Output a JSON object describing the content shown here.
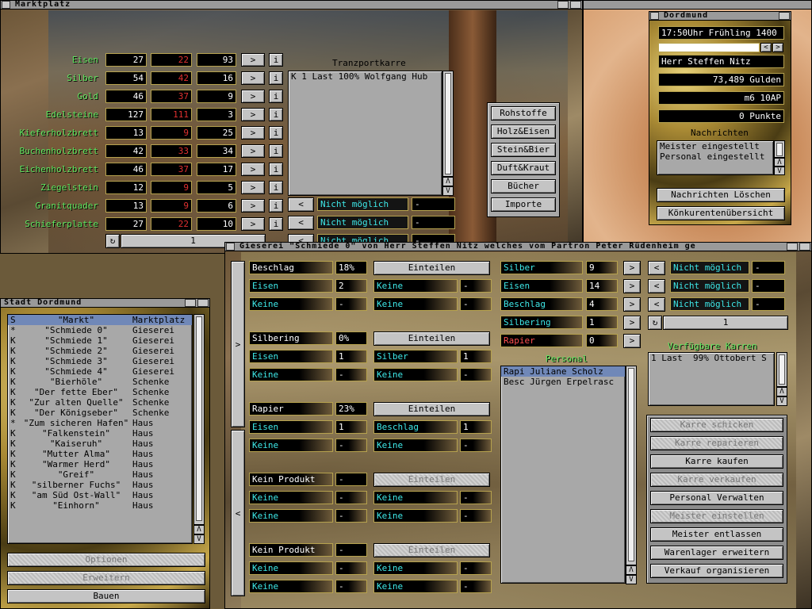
{
  "markt": {
    "title": "Marktplatz",
    "transport_title": "Tranzportkarre",
    "transport_items": [
      "K 1 Last 100% Wolfgang Hub"
    ],
    "goods": [
      {
        "name": "Eisen",
        "stock": "27",
        "price": "22",
        "own": "93"
      },
      {
        "name": "Silber",
        "stock": "54",
        "price": "42",
        "own": "16"
      },
      {
        "name": "Gold",
        "stock": "46",
        "price": "37",
        "own": "9"
      },
      {
        "name": "Edelsteine",
        "stock": "127",
        "price": "111",
        "own": "3"
      },
      {
        "name": "Kieferholzbrett",
        "stock": "13",
        "price": "9",
        "own": "25"
      },
      {
        "name": "Buchenholzbrett",
        "stock": "42",
        "price": "33",
        "own": "34"
      },
      {
        "name": "Eichenholzbrett",
        "stock": "46",
        "price": "37",
        "own": "17"
      },
      {
        "name": "Ziegelstein",
        "stock": "12",
        "price": "9",
        "own": "5"
      },
      {
        "name": "Granitquader",
        "stock": "13",
        "price": "9",
        "own": "6"
      },
      {
        "name": "Schieferplatte",
        "stock": "27",
        "price": "22",
        "own": "10"
      }
    ],
    "arrow_right": ">",
    "arrow_left": "<",
    "info": "i",
    "counter_icon": "↻",
    "counter_value": "1",
    "dash": "-",
    "not_possible": "Nicht möglich",
    "categories": [
      "Rohstoffe",
      "Holz&Eisen",
      "Stein&Bier",
      "Duft&Kraut",
      "Bücher",
      "Importe"
    ]
  },
  "dordmund": {
    "title": "Dordmund",
    "time": "17:50Uhr Frühling 1400",
    "player": "Herr Steffen Nitz",
    "gold": "73,489 Gulden",
    "ap": "m6 10AP",
    "points": "0 Punkte",
    "news_title": "Nachrichten",
    "news": [
      "Meister eingestellt",
      "Personal eingestellt"
    ],
    "btn_clear": "Nachrichten Löschen",
    "btn_competitors": "Könkurentenübersicht",
    "arrow_left": "<",
    "arrow_right": ">"
  },
  "stadt": {
    "title": "Stadt Dordmund",
    "buildings": [
      {
        "k": "S",
        "name": "\"Markt\"",
        "type": "Marktplatz"
      },
      {
        "k": "*",
        "name": "\"Schmiede 0\"",
        "type": "Gieserei"
      },
      {
        "k": "K",
        "name": "\"Schmiede 1\"",
        "type": "Gieserei"
      },
      {
        "k": "K",
        "name": "\"Schmiede 2\"",
        "type": "Gieserei"
      },
      {
        "k": "K",
        "name": "\"Schmiede 3\"",
        "type": "Gieserei"
      },
      {
        "k": "K",
        "name": "\"Schmiede 4\"",
        "type": "Gieserei"
      },
      {
        "k": "K",
        "name": "\"Bierhöle\"",
        "type": "Schenke"
      },
      {
        "k": "K",
        "name": "\"Der fette Eber\"",
        "type": "Schenke"
      },
      {
        "k": "K",
        "name": "\"Zur alten Quelle\"",
        "type": "Schenke"
      },
      {
        "k": "K",
        "name": "\"Der Königseber\"",
        "type": "Schenke"
      },
      {
        "k": "*",
        "name": "\"Zum sicheren Hafen\"",
        "type": "Haus"
      },
      {
        "k": "K",
        "name": "\"Falkenstein\"",
        "type": "Haus"
      },
      {
        "k": "K",
        "name": "\"Kaiseruh\"",
        "type": "Haus"
      },
      {
        "k": "K",
        "name": "\"Mutter Alma\"",
        "type": "Haus"
      },
      {
        "k": "K",
        "name": "\"Warmer Herd\"",
        "type": "Haus"
      },
      {
        "k": "K",
        "name": "\"Greif\"",
        "type": "Haus"
      },
      {
        "k": "K",
        "name": "\"silberner Fuchs\"",
        "type": "Haus"
      },
      {
        "k": "K",
        "name": "\"am Süd Ost-Wall\"",
        "type": "Haus"
      },
      {
        "k": "K",
        "name": "\"Einhorn\"",
        "type": "Haus"
      }
    ],
    "btn_options": "Optionen",
    "btn_expand": "Erweitern",
    "btn_build": "Bauen"
  },
  "gieserei": {
    "title": "Gieserei \"Schmiede 0\" von Herr Steffen Nitz welches vom Partron Peter Rüdenheim ge",
    "prod": [
      {
        "product": "Beschlag",
        "pct": "18%",
        "in": [
          {
            "a": "Eisen",
            "b": "2",
            "c": "Keine",
            "d": "-"
          },
          {
            "a": "Keine",
            "b": "-",
            "c": "Keine",
            "d": "-"
          }
        ]
      },
      {
        "product": "Silbering",
        "pct": "0%",
        "in": [
          {
            "a": "Eisen",
            "b": "1",
            "c": "Silber",
            "d": "1"
          },
          {
            "a": "Keine",
            "b": "-",
            "c": "Keine",
            "d": "-"
          }
        ]
      },
      {
        "product": "Rapier",
        "pct": "23%",
        "in": [
          {
            "a": "Eisen",
            "b": "1",
            "c": "Beschlag",
            "d": "1"
          },
          {
            "a": "Keine",
            "b": "-",
            "c": "Keine",
            "d": "-"
          }
        ]
      },
      {
        "product": "Kein Produkt",
        "pct": "-",
        "in": [
          {
            "a": "Keine",
            "b": "-",
            "c": "Keine",
            "d": "-"
          },
          {
            "a": "Keine",
            "b": "-",
            "c": "Keine",
            "d": "-"
          }
        ]
      },
      {
        "product": "Kein Produkt",
        "pct": "-",
        "in": [
          {
            "a": "Keine",
            "b": "-",
            "c": "Keine",
            "d": "-"
          },
          {
            "a": "Keine",
            "b": "-",
            "c": "Keine",
            "d": "-"
          }
        ]
      }
    ],
    "btn_assign": "Einteilen",
    "stock": [
      {
        "name": "Silber",
        "qty": "9"
      },
      {
        "name": "Eisen",
        "qty": "14"
      },
      {
        "name": "Beschlag",
        "qty": "4"
      },
      {
        "name": "Silbering",
        "qty": "1"
      },
      {
        "name": "Rapier",
        "qty": "0"
      }
    ],
    "not_possible": "Nicht möglich",
    "dash": "-",
    "arrow_right": ">",
    "arrow_left": "<",
    "counter_icon": "↻",
    "counter_value": "1",
    "carts_title": "Verfügbare Karren",
    "carts": [
      "1 Last  99% Ottobert S"
    ],
    "personal_title": "Personal",
    "personal": [
      "Rapi Juliane Scholz",
      "Besc Jürgen Erpelrasc"
    ],
    "actions": [
      {
        "label": "Karre schicken",
        "dim": true
      },
      {
        "label": "Karre reparieren",
        "dim": true
      },
      {
        "label": "Karre kaufen",
        "dim": false
      },
      {
        "label": "Karre verkaufen",
        "dim": true
      },
      {
        "label": "Personal Verwalten",
        "dim": false
      },
      {
        "label": "Meister einstellen",
        "dim": true
      },
      {
        "label": "Meister entlassen",
        "dim": false
      },
      {
        "label": "Warenlager erweitern",
        "dim": false
      },
      {
        "label": "Verkauf organisieren",
        "dim": false
      }
    ]
  },
  "scroll_up": "Λ",
  "scroll_down": "V"
}
